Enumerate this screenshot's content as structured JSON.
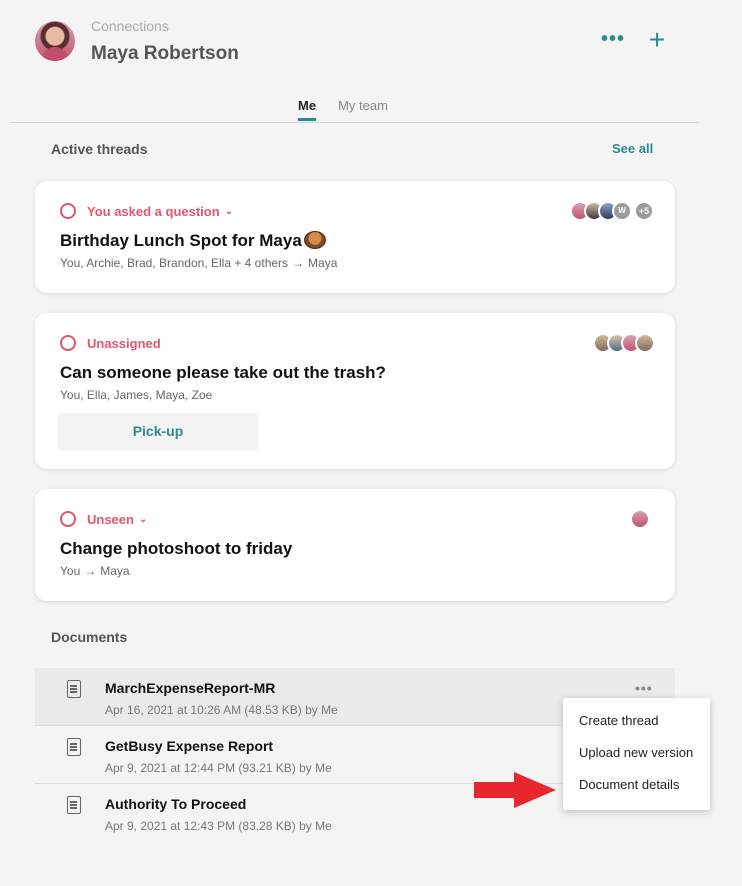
{
  "header": {
    "breadcrumb": "Connections",
    "name": "Maya Robertson"
  },
  "tabs": [
    {
      "label": "Me"
    },
    {
      "label": "My team"
    }
  ],
  "active_threads": {
    "title": "Active threads",
    "see_all": "See all",
    "threads": [
      {
        "status": "You asked a question",
        "title": "Birthday Lunch Spot for Maya",
        "participants": "You, Archie, Brad, Brandon, Ella + 4 others",
        "recipient": "Maya",
        "more_count": "+5",
        "avatar_initial": "W"
      },
      {
        "status": "Unassigned",
        "title": "Can someone please take out the trash?",
        "participants": "You, Ella, James, Maya, Zoe",
        "action": "Pick-up"
      },
      {
        "status": "Unseen",
        "title": "Change photoshoot to friday",
        "participants": "You",
        "recipient": "Maya"
      }
    ]
  },
  "documents": {
    "title": "Documents",
    "items": [
      {
        "name": "MarchExpenseReport-MR",
        "meta": "Apr 16, 2021 at 10:26 AM (48.53 KB) by Me"
      },
      {
        "name": "GetBusy Expense Report",
        "meta": "Apr 9, 2021 at 12:44 PM (93.21 KB) by Me"
      },
      {
        "name": "Authority To Proceed",
        "meta": "Apr 9, 2021 at 12:43 PM (83.28 KB) by Me"
      }
    ]
  },
  "context_menu": {
    "items": [
      {
        "label": "Create thread"
      },
      {
        "label": "Upload new version"
      },
      {
        "label": "Document details"
      }
    ]
  },
  "colors": {
    "accent": "#2a8c8a",
    "status": "#e0566b",
    "annotation_arrow": "#e8262d"
  }
}
